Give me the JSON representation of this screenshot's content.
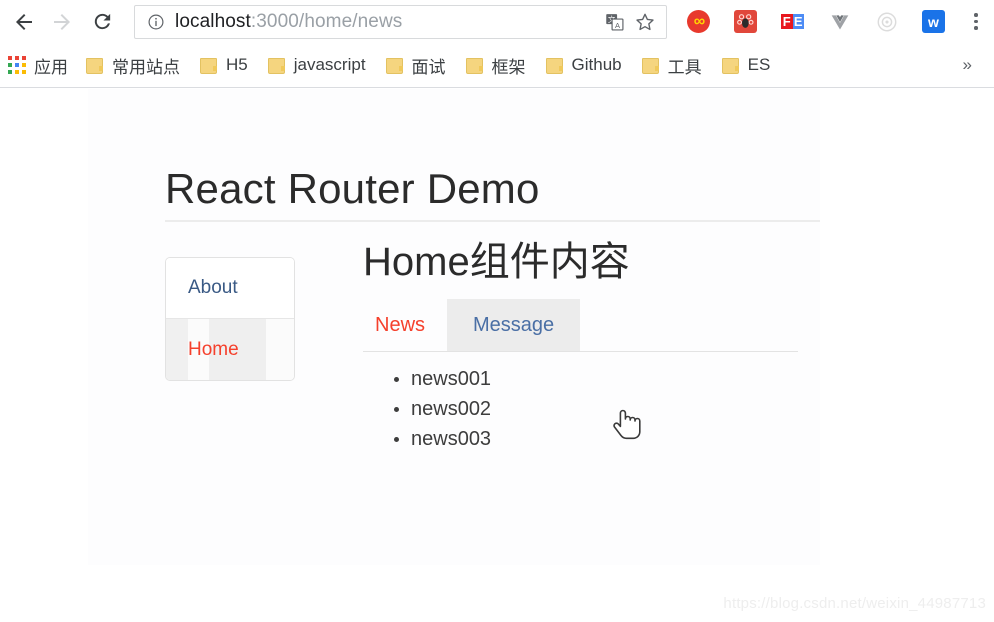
{
  "browser": {
    "nav": {
      "back_icon": "arrow-left-icon",
      "forward_icon": "arrow-right-icon",
      "reload_icon": "reload-icon"
    },
    "omnibox": {
      "info_icon": "info-circle-icon",
      "url_host": "localhost",
      "url_path": ":3000/home/news",
      "translate_icon": "translate-icon",
      "bookmark_icon": "star-icon"
    },
    "extensions": [
      {
        "name": "infinity-extension-icon",
        "glyph": "∞",
        "bg": "#e8392d",
        "fg": "#ffd400"
      },
      {
        "name": "bee-extension-icon",
        "glyph": "",
        "bg": "#e1473b",
        "fg": "#ffffff"
      },
      {
        "name": "fe-extension-icon",
        "glyph": "FE",
        "bg": "#e8161d",
        "fg": "#ffffff"
      },
      {
        "name": "vue-devtools-extension-icon",
        "glyph": "V",
        "bg": "transparent",
        "fg": "#9aa0a6"
      },
      {
        "name": "target-extension-icon",
        "glyph": "",
        "bg": "transparent",
        "fg": "#d8d8d8"
      },
      {
        "name": "w-extension-icon",
        "glyph": "w",
        "bg": "#1a73e8",
        "fg": "#ffffff"
      }
    ],
    "menu_icon": "three-dots-menu-icon"
  },
  "bookmarks_bar": {
    "apps_label": "应用",
    "apps_icon": "apps-grid-icon",
    "items": [
      {
        "label": "常用站点"
      },
      {
        "label": "H5"
      },
      {
        "label": "javascript"
      },
      {
        "label": "面试"
      },
      {
        "label": "框架"
      },
      {
        "label": "Github"
      },
      {
        "label": "工具"
      },
      {
        "label": "ES"
      }
    ],
    "overflow_label": "»"
  },
  "page": {
    "title": "React Router Demo",
    "nav_panel": [
      {
        "label": "About",
        "active": false
      },
      {
        "label": "Home",
        "active": true
      }
    ],
    "content": {
      "heading": "Home组件内容",
      "tabs": [
        {
          "label": "News",
          "active": true
        },
        {
          "label": "Message",
          "active": false,
          "hovered": true
        }
      ],
      "news_items": [
        "news001",
        "news002",
        "news003"
      ]
    },
    "cursor_icon": "pointer-hand-cursor",
    "watermark": "https://blog.csdn.net/weixin_44987713"
  },
  "colors": {
    "active_link": "#f5402c",
    "link": "#3d5a80",
    "chrome_text": "#3c4043",
    "url_gray": "#9aa0a6"
  }
}
